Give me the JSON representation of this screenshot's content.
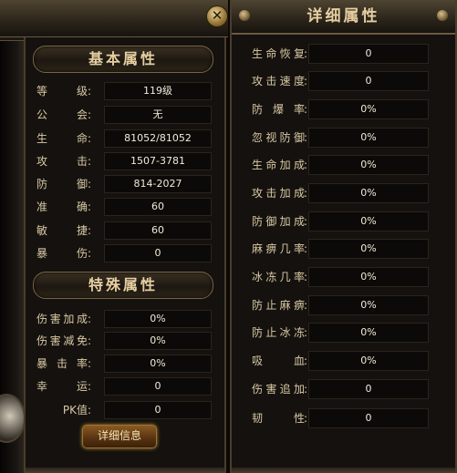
{
  "close_glyph": "✕",
  "basic": {
    "header": "基本属性",
    "rows": [
      {
        "label": "等级",
        "value": "119级"
      },
      {
        "label": "公会",
        "value": "无"
      },
      {
        "label": "生命",
        "value": "81052/81052"
      },
      {
        "label": "攻击",
        "value": "1507-3781"
      },
      {
        "label": "防御",
        "value": "814-2027"
      },
      {
        "label": "准确",
        "value": "60"
      },
      {
        "label": "敏捷",
        "value": "60"
      },
      {
        "label": "暴伤",
        "value": "0"
      }
    ]
  },
  "special": {
    "header": "特殊属性",
    "rows": [
      {
        "label": "伤害加成",
        "value": "0%"
      },
      {
        "label": "伤害减免",
        "value": "0%"
      },
      {
        "label": "暴击率",
        "value": "0%"
      },
      {
        "label": "幸运",
        "value": "0"
      },
      {
        "label": "PK值",
        "value": "0"
      }
    ]
  },
  "detail_button_label": "详细信息",
  "detail": {
    "title": "详细属性",
    "rows": [
      {
        "label": "生命恢复",
        "value": "0"
      },
      {
        "label": "攻击速度",
        "value": "0"
      },
      {
        "label": "防爆率",
        "value": "0%"
      },
      {
        "label": "忽视防御",
        "value": "0%"
      },
      {
        "label": "生命加成",
        "value": "0%"
      },
      {
        "label": "攻击加成",
        "value": "0%"
      },
      {
        "label": "防御加成",
        "value": "0%"
      },
      {
        "label": "麻痹几率",
        "value": "0%"
      },
      {
        "label": "冰冻几率",
        "value": "0%"
      },
      {
        "label": "防止麻痹",
        "value": "0%"
      },
      {
        "label": "防止冰冻",
        "value": "0%"
      },
      {
        "label": "吸血",
        "value": "0%"
      },
      {
        "label": "伤害追加",
        "value": "0"
      },
      {
        "label": "韧性",
        "value": "0"
      }
    ]
  },
  "colors": {
    "panel_bg": "#14110e",
    "label_text": "#d9c8a4",
    "value_text": "#f0ead9",
    "header_text": "#e6cfa2",
    "border_gold": "#7a6444",
    "button_glow": "#b88a3a"
  },
  "icons": {
    "close": "close-icon"
  }
}
